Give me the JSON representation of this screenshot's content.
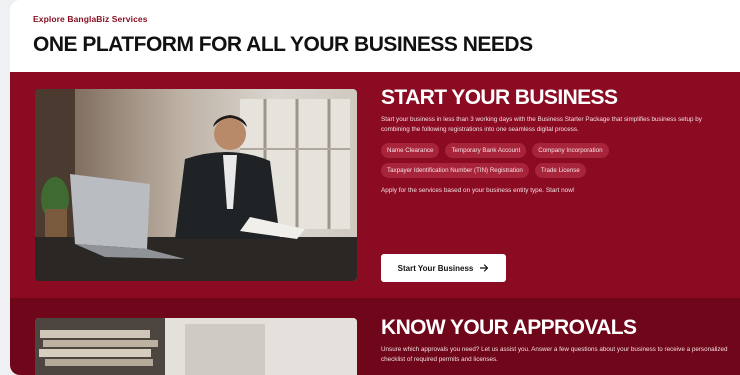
{
  "header": {
    "kicker": "Explore BanglaBiz Services",
    "headline": "ONE PLATFORM FOR ALL YOUR BUSINESS NEEDS"
  },
  "start": {
    "title": "START YOUR BUSINESS",
    "description": "Start your business in less than 3 working days with the Business Starter Package that simplifies business setup by combining the following registrations into one seamless digital process.",
    "chips": [
      "Name Clearance",
      "Temporary Bank Account",
      "Company Incorporation",
      "Taxpayer Identification Number (TIN) Registration",
      "Trade License"
    ],
    "apply_text": "Apply for the services based on your business entity type. Start now!",
    "cta_label": "Start Your Business",
    "cta_icon": "arrow-right-icon"
  },
  "approvals": {
    "title": "KNOW YOUR APPROVALS",
    "description": "Unsure which approvals you need? Let us assist you. Answer a few questions about your business to receive a personalized checklist of required permits and licenses."
  },
  "colors": {
    "brand": "#8b0b22",
    "brand_dark": "#6f0619",
    "kicker": "#8a0e22"
  }
}
